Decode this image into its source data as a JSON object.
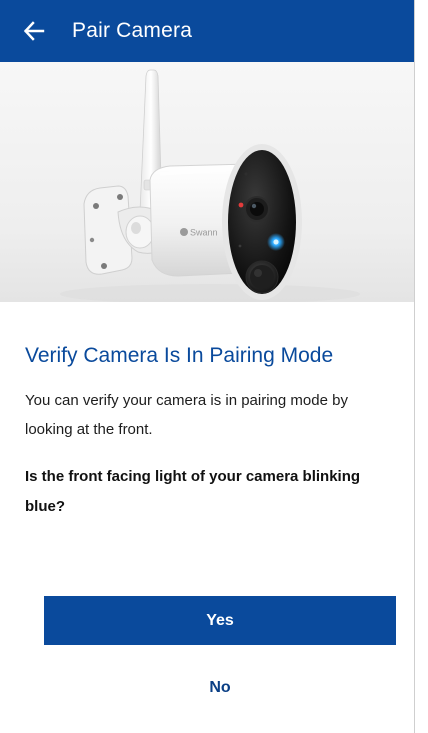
{
  "header": {
    "title": "Pair Camera",
    "back_icon": "arrow-left-icon"
  },
  "hero": {
    "brand_mark": "Swann",
    "led_color": "#2aa8ff"
  },
  "main": {
    "section_title": "Verify Camera Is In Pairing Mode",
    "description": "You can verify your camera is in pairing mode by looking at the front.",
    "question": "Is the front facing light of your camera blinking blue?"
  },
  "actions": {
    "yes_label": "Yes",
    "no_label": "No"
  },
  "colors": {
    "brand_blue": "#0a4a9c",
    "background": "#ffffff"
  }
}
